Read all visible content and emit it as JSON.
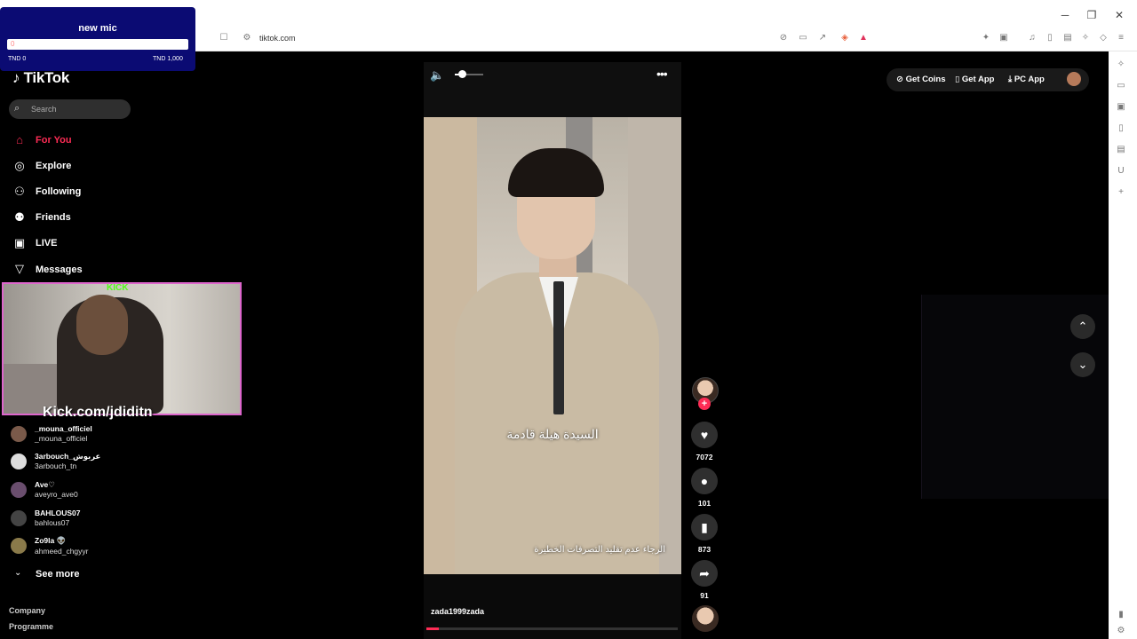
{
  "browser": {
    "url": "tiktok.com",
    "window_controls": {
      "minimize": "─",
      "restore": "❐",
      "close": "✕"
    }
  },
  "mic_widget": {
    "title": "new mic",
    "value": "0",
    "min_label": "TND 0",
    "max_label": "TND 1,000"
  },
  "sidebar": {
    "logo": "TikTok",
    "search_placeholder": "Search",
    "nav": [
      {
        "label": "For You",
        "icon": "home-icon"
      },
      {
        "label": "Explore",
        "icon": "compass-icon"
      },
      {
        "label": "Following",
        "icon": "following-icon"
      },
      {
        "label": "Friends",
        "icon": "friends-icon"
      },
      {
        "label": "LIVE",
        "icon": "live-icon"
      },
      {
        "label": "Messages",
        "icon": "messages-icon"
      }
    ],
    "following_accounts": [
      {
        "name": "_mouna_officiel",
        "handle": "_mouna_officiel"
      },
      {
        "name": "3arbouch_عربوش",
        "handle": "3arbouch_tn"
      },
      {
        "name": "Ave♡",
        "handle": "aveyro_ave0"
      },
      {
        "name": "BAHLOUS07",
        "handle": "bahlous07"
      },
      {
        "name": "Zo9la 👽",
        "handle": "ahmeed_chgyyr"
      }
    ],
    "see_more": "See more",
    "footer": [
      "Company",
      "Programme"
    ]
  },
  "webcam": {
    "badge": "KICK",
    "url": "Kick.com/jdiditn"
  },
  "video": {
    "caption_main": "السيدة هيلة قادمة",
    "caption_warning": "الرجاء عدم تقليد التصرفات الخطيرة",
    "author": "zada1999zada",
    "progress": 0.05,
    "volume": 0.35
  },
  "actions": {
    "likes": "7072",
    "comments": "101",
    "saves": "873",
    "shares": "91"
  },
  "topbar": {
    "get_coins": "Get Coins",
    "get_app": "Get App",
    "pc_app": "PC App"
  }
}
